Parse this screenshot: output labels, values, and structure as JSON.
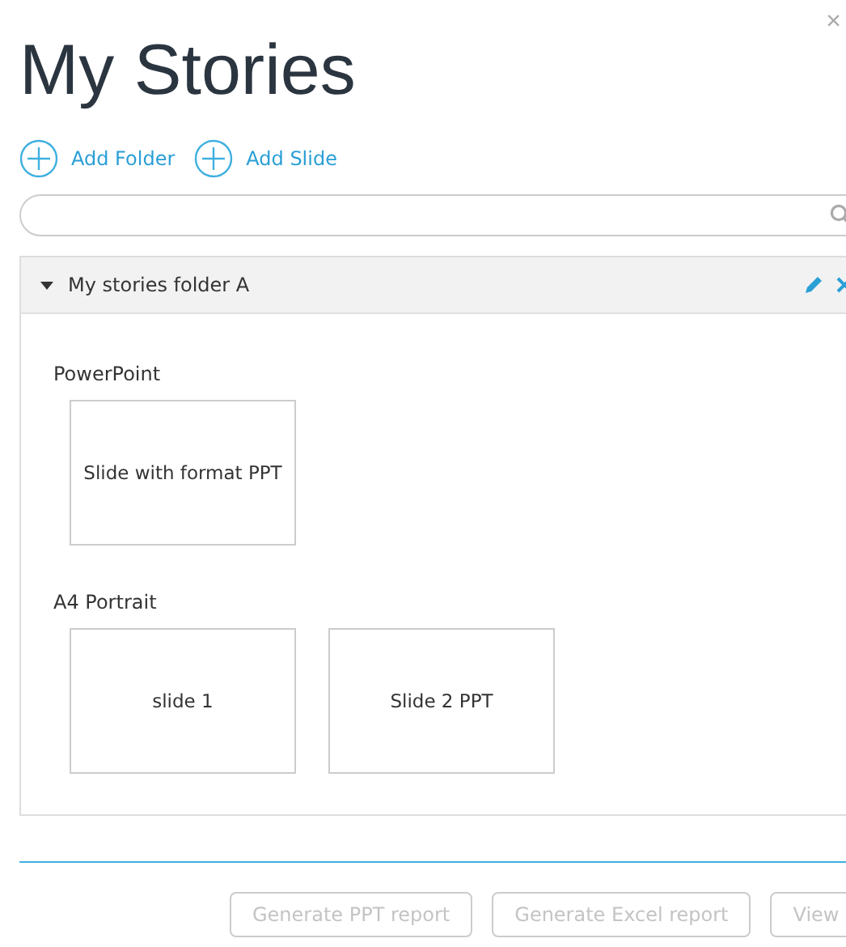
{
  "title": "My Stories",
  "close": "×",
  "actions": [
    {
      "label": "Add Folder"
    },
    {
      "label": "Add Slide"
    }
  ],
  "folders": [
    {
      "name": "My stories folder A",
      "expanded": true,
      "groups": [
        {
          "name": "PowerPoint",
          "slides": [
            {
              "title": "Slide with format PPT"
            }
          ]
        },
        {
          "name": "A4 Portrait",
          "slides": [
            {
              "title": "slide 1"
            },
            {
              "title": "Slide 2 PPT"
            }
          ]
        }
      ]
    }
  ],
  "buttons": [
    {
      "label": "Generate PPT report",
      "disabled": true
    },
    {
      "label": "Generate Excel report",
      "disabled": true
    },
    {
      "label": "View",
      "disabled": true
    }
  ]
}
